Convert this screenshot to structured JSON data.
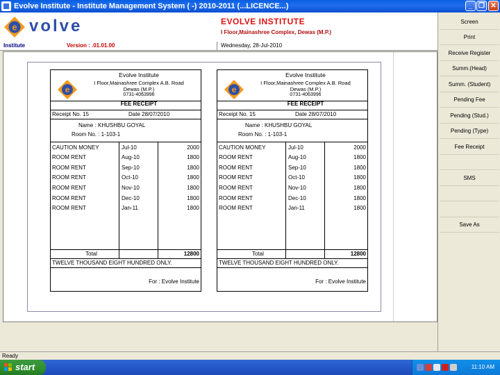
{
  "window": {
    "title": "Evolve Institute - Institute Management System ( -) 2010-2011 (...LICENCE...)",
    "minimize": "_",
    "maximize": "❐",
    "close": "✕"
  },
  "header": {
    "logo_text": "volve",
    "institute_name": "EVOLVE INSTITUTE",
    "address": "I Floor,Mainashree Complex, Dewas (M.P.)"
  },
  "infobar": {
    "label": "Institute",
    "version": "Version : .01.01.00",
    "date": "Wednesday, 28-Jul-2010"
  },
  "receipt": {
    "name": "Evolve Institute",
    "addr1": "I Floor,Mainashree Complex A.B. Road",
    "addr2": "Dewas (M.P.)",
    "phone": "0731-4063996",
    "title": "FEE RECEIPT",
    "receipt_no": "Receipt No. 15",
    "date": "Date  28/07/2010",
    "student": "Name : KHUSHBU  GOYAL",
    "room": "Room No. : 1-103-1",
    "rows": [
      {
        "desc": "CAUTION MONEY",
        "month": "Jul-10",
        "amount": "2000"
      },
      {
        "desc": "ROOM RENT",
        "month": "Aug-10",
        "amount": "1800"
      },
      {
        "desc": "ROOM RENT",
        "month": "Sep-10",
        "amount": "1800"
      },
      {
        "desc": "ROOM RENT",
        "month": "Oct-10",
        "amount": "1800"
      },
      {
        "desc": "ROOM RENT",
        "month": "Nov-10",
        "amount": "1800"
      },
      {
        "desc": "ROOM RENT",
        "month": "Dec-10",
        "amount": "1800"
      },
      {
        "desc": "ROOM RENT",
        "month": "Jan-11",
        "amount": "1800"
      }
    ],
    "total_label": "Total",
    "total_value": "12800",
    "amount_words": "TWELVE THOUSAND EIGHT HUNDRED  ONLY.",
    "for_line": "For  :  Evolve Institute"
  },
  "sidebar": {
    "items": [
      "Screen",
      "Print",
      "Receive Register",
      "Summ.(Head)",
      "Summ. (Student)",
      "Pending Fee",
      "Pending (Stud.)",
      "Pending (Type)",
      "Fee Receipt",
      "",
      "SMS",
      "",
      "",
      "Save As"
    ]
  },
  "statusbar": {
    "text": "Ready"
  },
  "taskbar": {
    "start_label": "start",
    "clock": "11:10 AM"
  },
  "colors": {
    "accent": "#2d4fa8",
    "institute_red": "#e01010",
    "logo_orange": "#f39a1e"
  }
}
